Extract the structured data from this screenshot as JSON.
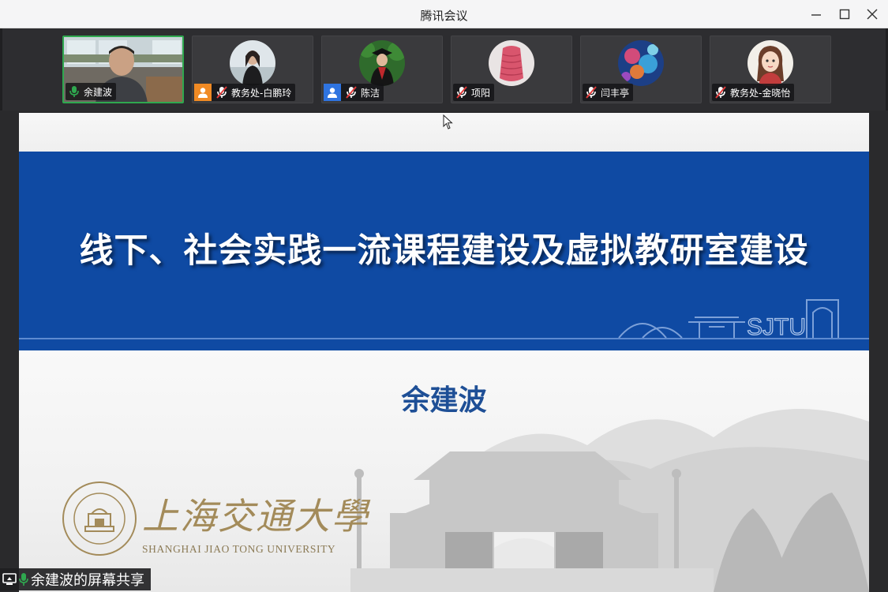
{
  "window": {
    "title": "腾讯会议"
  },
  "participants": [
    {
      "name": "余建波",
      "mic": "on",
      "active": true,
      "avatar": "video-feed"
    },
    {
      "name": "教务处-白鹏玲",
      "mic": "muted",
      "active": false,
      "avatar": "photo-woman-seated",
      "badge": "orange"
    },
    {
      "name": "陈洁",
      "mic": "muted",
      "active": false,
      "avatar": "photo-graduate",
      "badge": "blue"
    },
    {
      "name": "项阳",
      "mic": "muted",
      "active": false,
      "avatar": "photo-pink-vase"
    },
    {
      "name": "闫丰亭",
      "mic": "muted",
      "active": false,
      "avatar": "photo-coral"
    },
    {
      "name": "教务处-金晓怡",
      "mic": "muted",
      "active": false,
      "avatar": "cartoon-girl"
    }
  ],
  "slide": {
    "headline": "线下、社会实践一流课程建设及虚拟教研室建设",
    "band_mark": "SJTU",
    "presenter": "余建波",
    "university_cn": "上海交通大學",
    "university_en": "SHANGHAI JIAO TONG UNIVERSITY",
    "colors": {
      "band": "#0f4aa3",
      "presenter": "#1e4f96",
      "logo": "#a38b5a"
    }
  },
  "share_label": "余建波的屏幕共享",
  "colors": {
    "mic_on": "#2fa84f",
    "mic_muted": "#e03a3a",
    "active_border": "#2fa84f"
  }
}
